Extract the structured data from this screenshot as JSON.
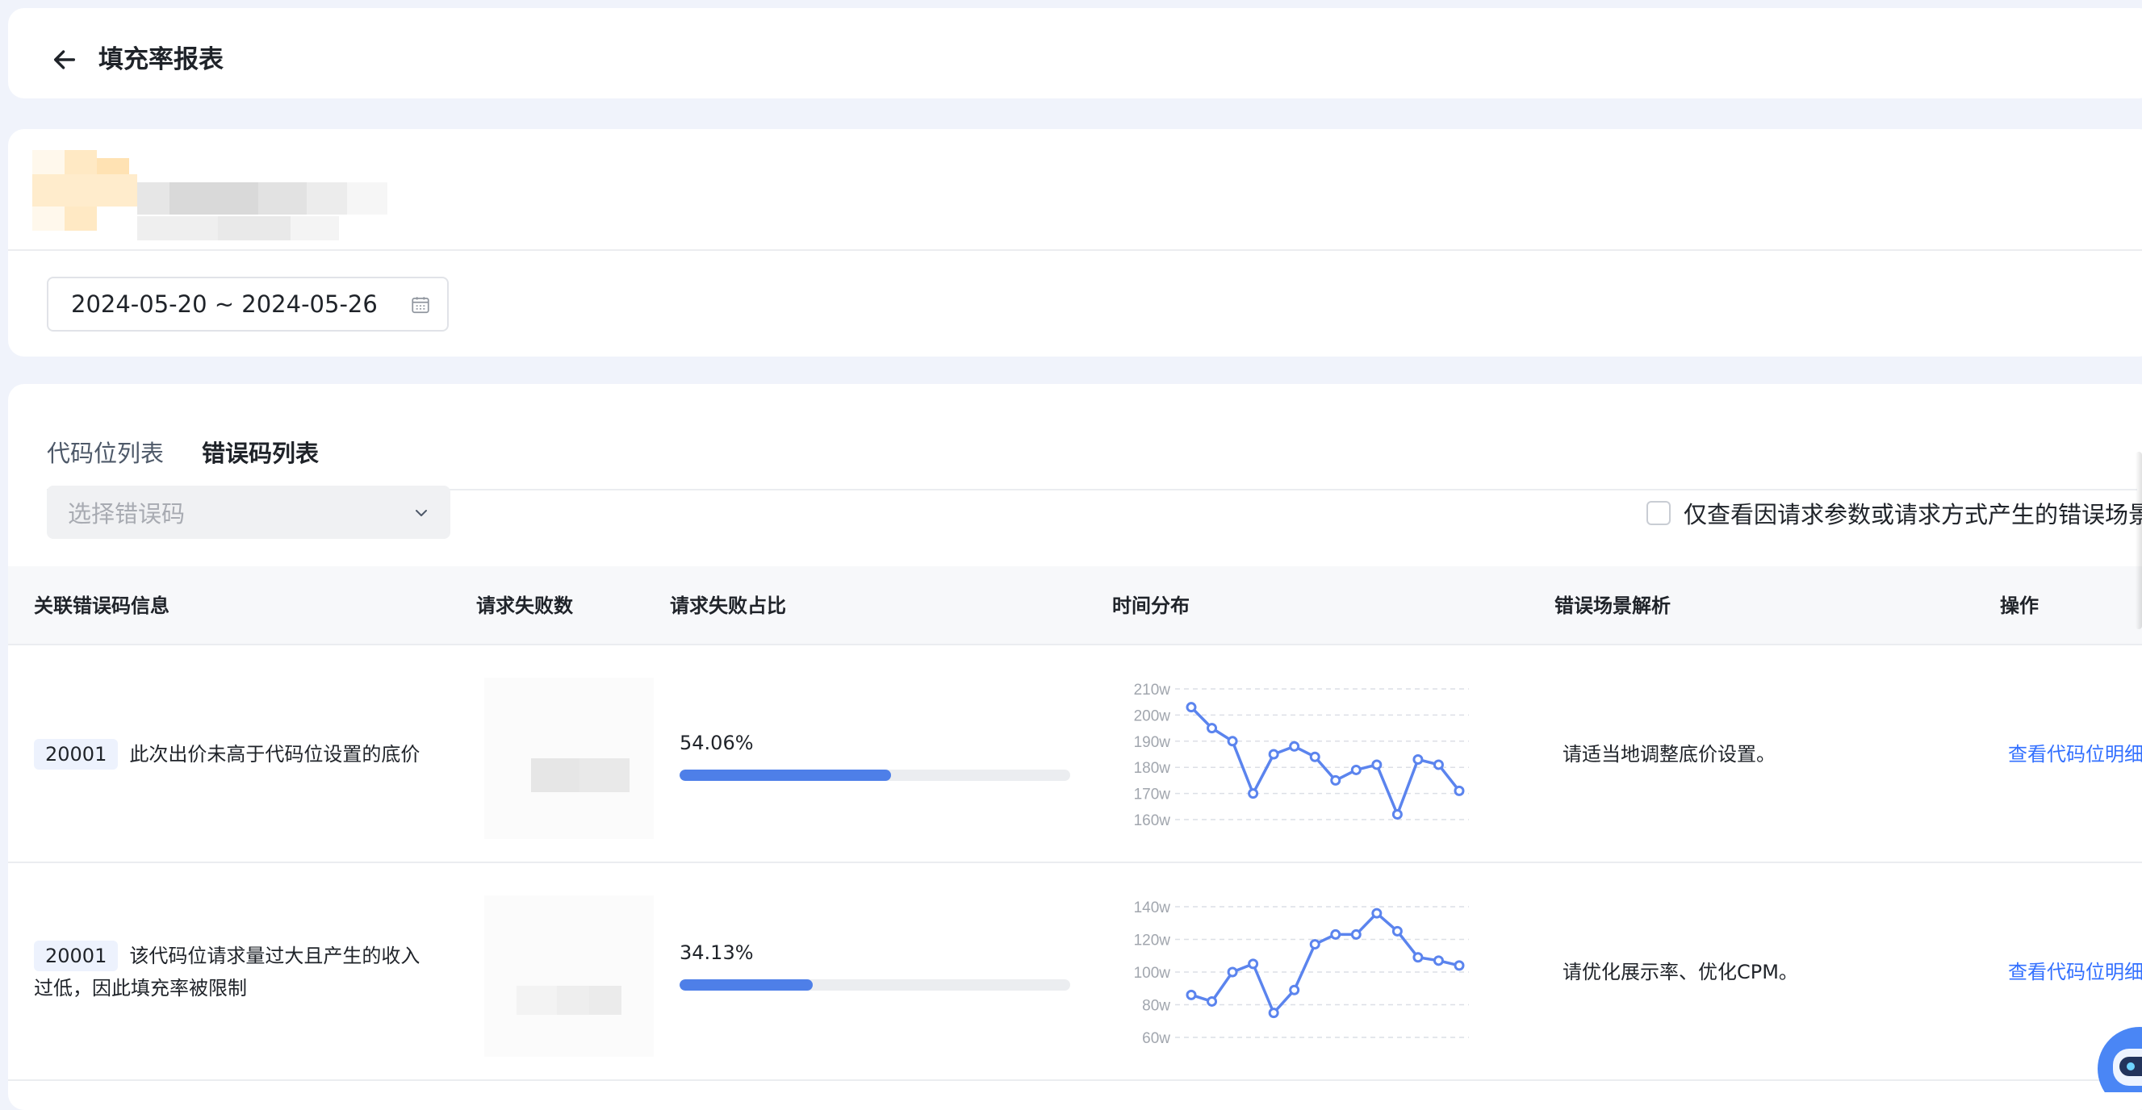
{
  "header": {
    "title": "填充率报表",
    "back_icon": "arrow-left-icon"
  },
  "filters": {
    "date_range": "2024-05-20 ~ 2024-05-26",
    "calendar_icon": "calendar-icon"
  },
  "tabs": [
    {
      "label": "代码位列表",
      "active": false
    },
    {
      "label": "错误码列表",
      "active": true
    }
  ],
  "error_select": {
    "placeholder": "选择错误码",
    "chevron_icon": "chevron-down-icon"
  },
  "checkbox": {
    "label": "仅查看因请求参数或请求方式产生的错误场景",
    "checked": false
  },
  "table": {
    "columns": [
      "关联错误码信息",
      "请求失败数",
      "请求失败占比",
      "时间分布",
      "错误场景解析",
      "操作"
    ],
    "rows": [
      {
        "code": "20001",
        "desc": "此次出价未高于代码位设置的底价",
        "ratio": "54.06%",
        "ratio_value": 54.06,
        "analysis": "请适当地调整底价设置。",
        "action": "查看代码位明细",
        "trend": {
          "yticks": [
            "210w",
            "200w",
            "190w",
            "180w",
            "170w",
            "160w"
          ],
          "ymin": 160,
          "ymax": 210,
          "values": [
            203,
            195,
            190,
            170,
            185,
            188,
            184,
            175,
            179,
            181,
            162,
            183,
            181,
            171
          ]
        }
      },
      {
        "code": "20001",
        "desc": "该代码位请求量过大且产生的收入过低，因此填充率被限制",
        "ratio": "34.13%",
        "ratio_value": 34.13,
        "analysis": "请优化展示率、优化CPM。",
        "action": "查看代码位明细",
        "trend": {
          "yticks": [
            "140w",
            "120w",
            "100w",
            "80w",
            "60w"
          ],
          "ymin": 60,
          "ymax": 140,
          "values": [
            86,
            82,
            100,
            105,
            75,
            89,
            117,
            123,
            123,
            136,
            125,
            109,
            107,
            104
          ]
        }
      }
    ]
  },
  "colors": {
    "accent": "#3370ff",
    "bar_fill": "#4e7fe8",
    "line": "#5b84ee",
    "badge_bg": "#edf2fd"
  }
}
